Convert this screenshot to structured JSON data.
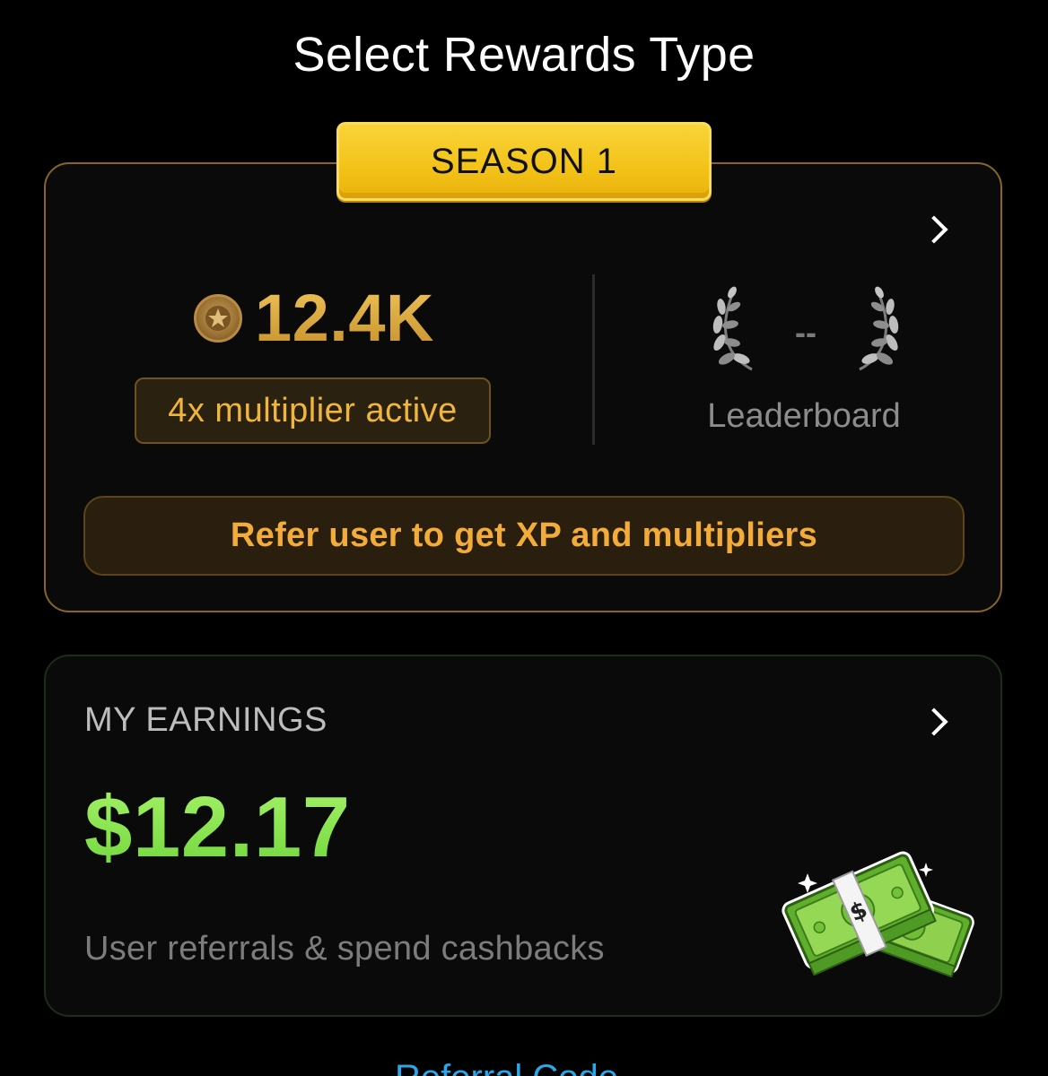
{
  "page": {
    "title": "Select Rewards Type"
  },
  "season_card": {
    "badge": "SEASON 1",
    "xp_value": "12.4K",
    "multiplier": "4x multiplier active",
    "rank": "--",
    "leaderboard_label": "Leaderboard",
    "refer_button": "Refer user to get XP and multipliers",
    "chevron_icon": "chevron-right-icon",
    "coin_icon": "star-coin-icon",
    "laurel_icon": "laurel-wreath-icon"
  },
  "earnings_card": {
    "title": "MY EARNINGS",
    "amount": "$12.17",
    "subtitle": "User referrals & spend cashbacks",
    "chevron_icon": "chevron-right-icon",
    "money_icon": "cash-stack-icon"
  },
  "footer": {
    "link": "Referral Code"
  },
  "colors": {
    "background": "#000000",
    "gold_accent": "#f0b53c",
    "badge_yellow": "#f3c218",
    "green_amount": "#8be24f",
    "link_blue": "#2ba7e8"
  }
}
